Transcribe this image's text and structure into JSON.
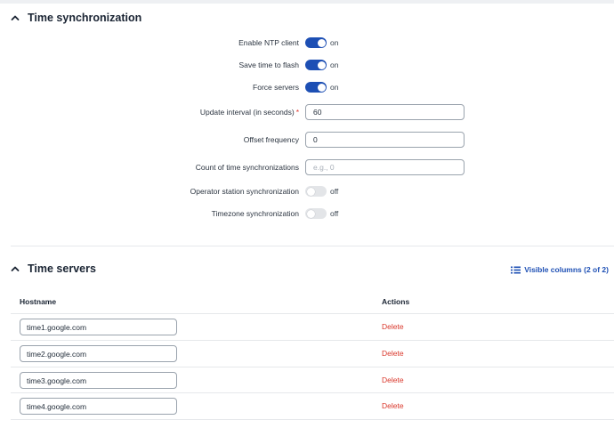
{
  "time_sync": {
    "title": "Time synchronization",
    "fields": [
      {
        "label": "Enable NTP client",
        "type": "toggle",
        "on": true,
        "state": "on"
      },
      {
        "label": "Save time to flash",
        "type": "toggle",
        "on": true,
        "state": "on"
      },
      {
        "label": "Force servers",
        "type": "toggle",
        "on": true,
        "state": "on"
      },
      {
        "label": "Update interval (in seconds)",
        "required_mark": "*",
        "type": "input",
        "value": "60"
      },
      {
        "label": "Offset frequency",
        "type": "input",
        "value": "0"
      },
      {
        "label": "Count of time synchronizations",
        "type": "input",
        "value": "",
        "placeholder": "e.g., 0"
      },
      {
        "label": "Operator station synchronization",
        "type": "toggle",
        "on": false,
        "state": "off"
      },
      {
        "label": "Timezone synchronization",
        "type": "toggle",
        "on": false,
        "state": "off"
      }
    ]
  },
  "time_servers": {
    "title": "Time servers",
    "visible_columns_label": "Visible columns (2 of 2)",
    "columns": [
      "Hostname",
      "Actions"
    ],
    "rows": [
      {
        "hostname": "time1.google.com",
        "action": "Delete"
      },
      {
        "hostname": "time2.google.com",
        "action": "Delete"
      },
      {
        "hostname": "time3.google.com",
        "action": "Delete"
      },
      {
        "hostname": "time4.google.com",
        "action": "Delete"
      }
    ]
  },
  "colors": {
    "accent": "#1d4fb4",
    "danger": "#d9372b",
    "toggle_off": "#e3e5e8"
  },
  "icons": {
    "section_toggle": "chevron-up-icon",
    "columns": "columns-icon"
  }
}
